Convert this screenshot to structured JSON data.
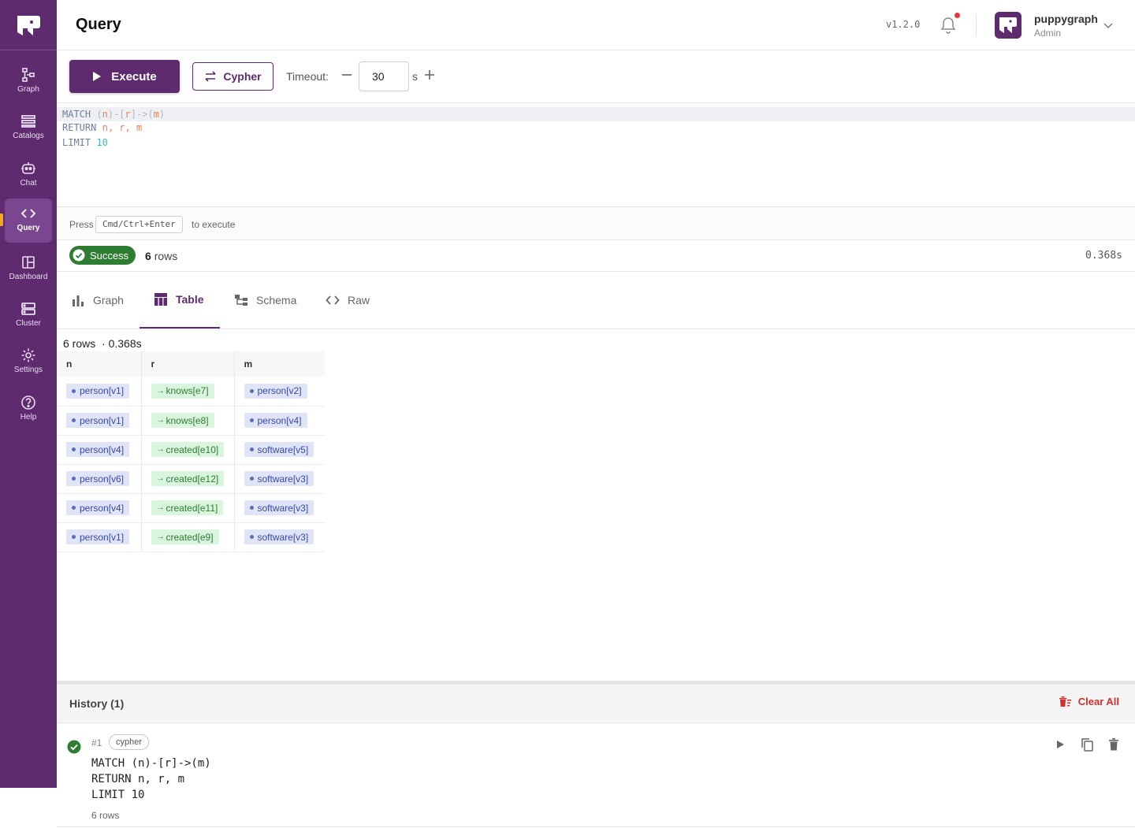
{
  "app": {
    "title": "Query",
    "version": "v1.2.0"
  },
  "user": {
    "name": "puppygraph",
    "role": "Admin"
  },
  "sidebar": {
    "items": [
      {
        "label": "Graph",
        "icon": "graph-icon"
      },
      {
        "label": "Catalogs",
        "icon": "catalogs-icon"
      },
      {
        "label": "Chat",
        "icon": "chat-bot-icon"
      },
      {
        "label": "Query",
        "icon": "code-icon",
        "active": true
      },
      {
        "label": "Dashboard",
        "icon": "dashboard-icon"
      },
      {
        "label": "Cluster",
        "icon": "cluster-icon"
      },
      {
        "label": "Settings",
        "icon": "gear-icon"
      },
      {
        "label": "Help",
        "icon": "help-icon"
      }
    ]
  },
  "toolbar": {
    "execute_label": "Execute",
    "language_label": "Cypher",
    "timeout_label": "Timeout:",
    "timeout_value": "30",
    "timeout_unit": "s"
  },
  "editor": {
    "lines": [
      {
        "kw": "MATCH",
        "a": "(",
        "n": "n",
        "b": ")-[",
        "r": "r",
        "c": "]->(",
        "m": "m",
        "d": ")"
      },
      {
        "kw": "RETURN",
        "rest": "n, r, m"
      },
      {
        "kw": "LIMIT",
        "num": "10"
      }
    ]
  },
  "hint": {
    "pre": "Press",
    "key": "Cmd/Ctrl+Enter",
    "post": "to execute"
  },
  "status": {
    "badge": "Success",
    "rows_count": "6",
    "rows_unit": "rows",
    "time": "0.368s"
  },
  "tabs": [
    {
      "label": "Graph",
      "icon": "bar-chart-icon"
    },
    {
      "label": "Table",
      "icon": "table-icon",
      "active": true
    },
    {
      "label": "Schema",
      "icon": "schema-icon"
    },
    {
      "label": "Raw",
      "icon": "code-icon"
    }
  ],
  "results": {
    "meta_rows": "6 rows",
    "meta_time": "· 0.368s",
    "columns": [
      "n",
      "r",
      "m"
    ],
    "rows": [
      [
        "person[v1]",
        "knows[e7]",
        "person[v2]"
      ],
      [
        "person[v1]",
        "knows[e8]",
        "person[v4]"
      ],
      [
        "person[v4]",
        "created[e10]",
        "software[v5]"
      ],
      [
        "person[v6]",
        "created[e12]",
        "software[v3]"
      ],
      [
        "person[v4]",
        "created[e11]",
        "software[v3]"
      ],
      [
        "person[v1]",
        "created[e9]",
        "software[v3]"
      ]
    ]
  },
  "history": {
    "title": "History (1)",
    "clear_label": "Clear All",
    "items": [
      {
        "num": "#1",
        "lang": "cypher",
        "lines": [
          "MATCH (n)-[r]->(m)",
          "RETURN n, r, m",
          "LIMIT 10"
        ],
        "rows": "6 rows"
      }
    ]
  },
  "colors": {
    "brand": "#5e2b6e",
    "success": "#2e7d32",
    "danger": "#d32f2f"
  }
}
